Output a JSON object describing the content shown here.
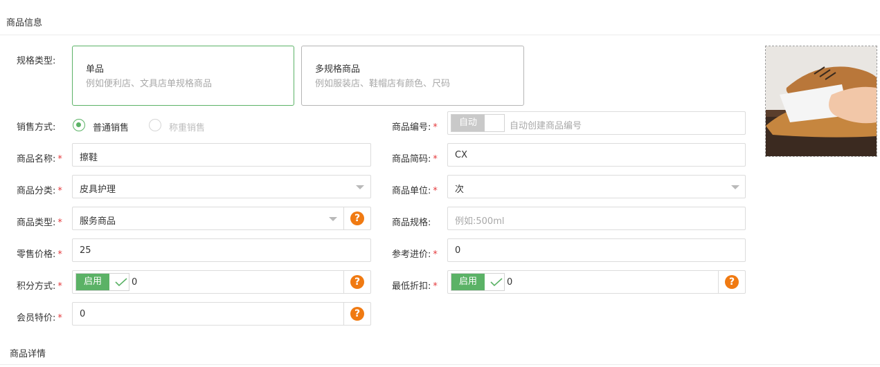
{
  "sections": {
    "product_info": "商品信息",
    "product_detail": "商品详情"
  },
  "spec_type": {
    "label": "规格类型:",
    "options": [
      {
        "title": "单品",
        "desc": "例如便利店、文具店单规格商品",
        "selected": true
      },
      {
        "title": "多规格商品",
        "desc": "例如服装店、鞋帽店有颜色、尺码",
        "selected": false
      }
    ]
  },
  "sale_mode": {
    "label": "销售方式:",
    "options": [
      {
        "label": "普通销售",
        "selected": true
      },
      {
        "label": "称重销售",
        "selected": false,
        "disabled": true
      }
    ]
  },
  "product_code": {
    "label": "商品编号:",
    "toggle_label": "自动",
    "placeholder": "自动创建商品编号"
  },
  "product_name": {
    "label": "商品名称:",
    "value": "擦鞋"
  },
  "short_code": {
    "label": "商品简码:",
    "value": "CX"
  },
  "category": {
    "label": "商品分类:",
    "value": "皮具护理"
  },
  "unit": {
    "label": "商品单位:",
    "value": "次"
  },
  "product_type": {
    "label": "商品类型:",
    "value": "服务商品",
    "help": "?"
  },
  "spec": {
    "label": "商品规格:",
    "placeholder": "例如:500ml"
  },
  "retail_price": {
    "label": "零售价格:",
    "value": "25"
  },
  "ref_cost": {
    "label": "参考进价:",
    "value": "0"
  },
  "points_mode": {
    "label": "积分方式:",
    "toggle_label": "启用",
    "value": "0",
    "help": "?"
  },
  "min_discount": {
    "label": "最低折扣:",
    "toggle_label": "启用",
    "value": "0",
    "help": "?"
  },
  "member_price": {
    "label": "会员特价:",
    "value": "0",
    "help": "?"
  },
  "required_mark": "*",
  "colors": {
    "accent": "#5bb266",
    "help": "#f07a12",
    "required": "#e4393c"
  }
}
